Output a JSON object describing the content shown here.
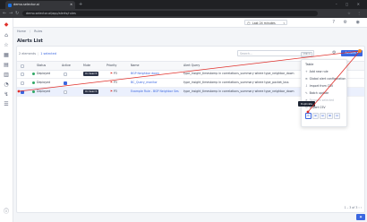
{
  "browser": {
    "tab_title": "demo.selector.ai",
    "new_tab": "+",
    "window_controls": "– ◻ ✕",
    "url": "demo.selector.ai/app/alerts/rules",
    "extras": "☆ ⋮"
  },
  "sidebar": {
    "icons": [
      "logo-icon",
      "home-icon",
      "star-icon",
      "grid-icon",
      "chart-icon",
      "book-icon",
      "bell-icon",
      "bolt-icon",
      "list-icon",
      "info-icon"
    ]
  },
  "appbar": {
    "workspace": "Last 24 minutes",
    "icons": "? ⚙ ◉"
  },
  "breadcrumbs": [
    "Home",
    "Rules"
  ],
  "page_title": "Alerts List",
  "table": {
    "summary_count": "2 elements",
    "summary_selected": "1 selected",
    "search_placeholder": "Search...",
    "search_shortcut": "CMD K",
    "actions_label": "Actions",
    "headers": [
      "Status",
      "Active",
      "Mute",
      "Priority",
      "Name",
      "Alert Query"
    ],
    "rows": [
      {
        "status": "Deployed",
        "active": false,
        "mute": "On Search",
        "priority": "P3",
        "name": "BGP Neighbor down",
        "query": "type_insight_timestamp in correlations_summary where type_neighbor_down"
      },
      {
        "status": "Deployed",
        "active": true,
        "mute": "",
        "priority": "P3",
        "name": "BC_Query_monitor",
        "query": "type_insight_timestamp in correlations_summary where type_packet_loss"
      },
      {
        "status": "Deployed",
        "active": false,
        "mute": "On Search",
        "priority": "P3",
        "name": "Example Rule - BGP Neighbor Ses",
        "query": "type_insight_timestamp in correlations_summary where type_neighbor_down"
      }
    ],
    "pager": "1 – 3 of 3   ‹ ›"
  },
  "popup": {
    "title": "Table",
    "items": [
      {
        "icon": "+",
        "label": "Add new rule",
        "enabled": true
      },
      {
        "icon": "⊕",
        "label": "Global alert configuration",
        "enabled": true
      },
      {
        "icon": "⇩",
        "label": "Import from CSV",
        "enabled": true
      },
      {
        "icon": "✎",
        "label": "Batch update",
        "enabled": true
      },
      {
        "icon": "✕",
        "label": "Remove selected",
        "enabled": false
      },
      {
        "icon": "↻",
        "label": "Export CSV",
        "enabled": true
      }
    ],
    "icon_buttons": [
      "⧉",
      "⊞",
      "⊟",
      "⊠",
      "⊡"
    ],
    "tooltip": "Duplicate"
  },
  "colors": {
    "accent": "#3b67e0",
    "status_deployed": "#2fa865",
    "annotation": "#e0302b"
  }
}
